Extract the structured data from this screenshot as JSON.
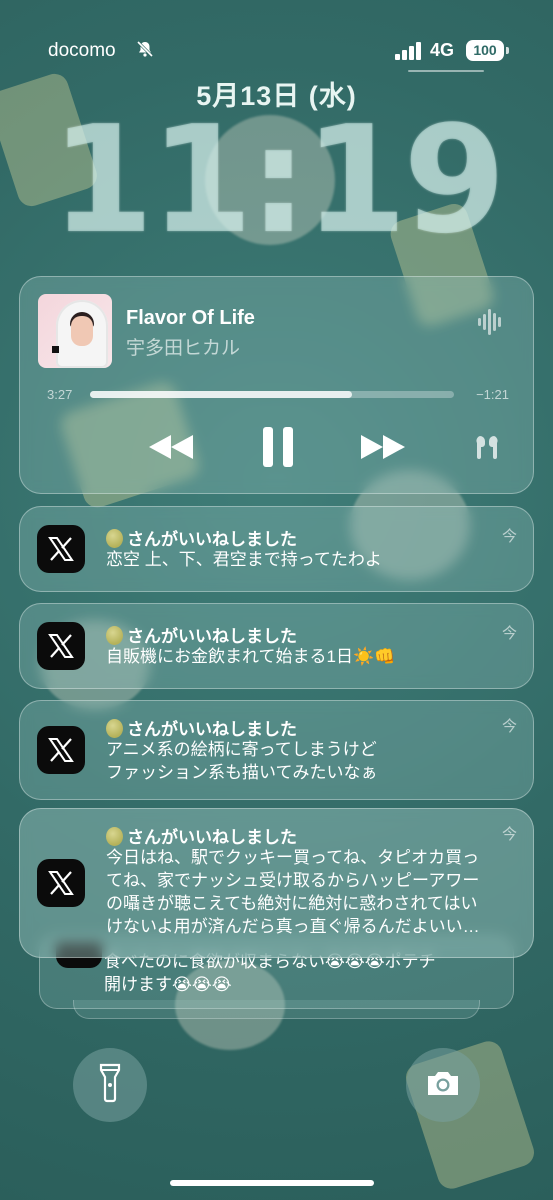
{
  "status": {
    "carrier": "docomo",
    "network": "4G",
    "battery": "100"
  },
  "lockscreen": {
    "date": "5月13日 (水)",
    "time": "11:19"
  },
  "now_playing": {
    "title": "Flavor Of Life",
    "artist": "宇多田ヒカル",
    "elapsed": "3:27",
    "remaining": "−1:21",
    "progress": 0.72
  },
  "notifications": [
    {
      "app": "X",
      "title": "さんがいいねしました",
      "body": [
        "恋空 上、下、君空まで持ってたわよ"
      ],
      "time": "今"
    },
    {
      "app": "X",
      "title": "さんがいいねしました",
      "body": [
        "自販機にお金飲まれて始まる1日☀️👊"
      ],
      "time": "今"
    },
    {
      "app": "X",
      "title": "さんがいいねしました",
      "body": [
        "アニメ系の絵柄に寄ってしまうけど",
        "ファッション系も描いてみたいなぁ"
      ],
      "time": "今"
    },
    {
      "app": "X",
      "title": "さんがいいねしました",
      "body": [
        "今日はね、駅でクッキー買ってね、タピオカ買っ",
        "てね、家でナッシュ受け取るからハッピーアワー",
        "の囁きが聴こえても絶対に絶対に惑わされてはい",
        "けないよ用が済んだら真っ直ぐ帰るんだよいい…"
      ],
      "time": "今"
    }
  ],
  "stacked_notification": {
    "body": [
      "食べたのに食欲が収まらない😭😭😭ポテチ",
      "開けます😭😭😭"
    ]
  },
  "colors": {
    "background": "#326a66",
    "accent": "#ffffff"
  },
  "icons": [
    "bell-slash-icon",
    "signal-icon",
    "battery-icon",
    "waveform-icon",
    "rewind-icon",
    "pause-icon",
    "fast-forward-icon",
    "airpods-icon",
    "x-logo-icon",
    "flashlight-icon",
    "camera-icon"
  ]
}
